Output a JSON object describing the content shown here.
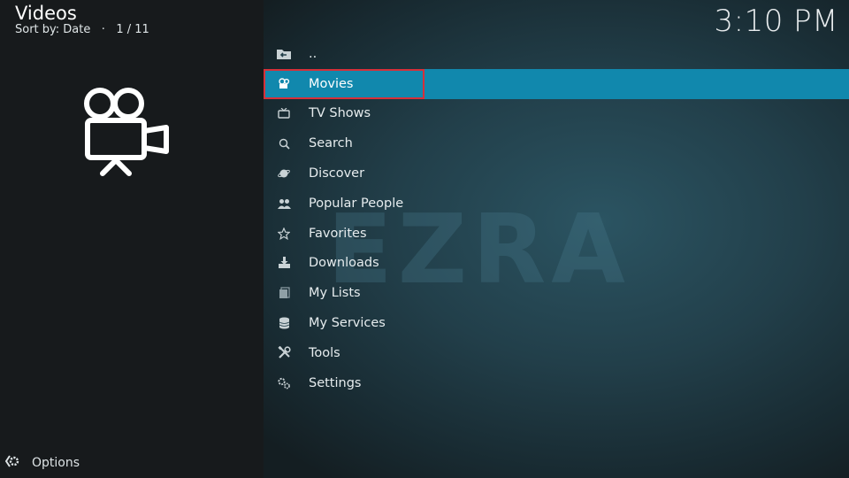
{
  "header": {
    "title": "Videos",
    "sort_text": "Sort by: Date",
    "position": "1 / 11",
    "clock": "3:10 PM"
  },
  "hero_icon": "video-camera-icon",
  "watermark": "EZRA",
  "list": [
    {
      "label": "..",
      "icon": "folder-back-icon"
    },
    {
      "label": "Movies",
      "icon": "film-reel-icon",
      "selected": true
    },
    {
      "label": "TV Shows",
      "icon": "tv-icon"
    },
    {
      "label": "Search",
      "icon": "search-icon"
    },
    {
      "label": "Discover",
      "icon": "planet-icon"
    },
    {
      "label": "Popular People",
      "icon": "people-icon"
    },
    {
      "label": "Favorites",
      "icon": "star-icon"
    },
    {
      "label": "Downloads",
      "icon": "download-icon"
    },
    {
      "label": "My Lists",
      "icon": "lists-icon"
    },
    {
      "label": "My Services",
      "icon": "database-icon"
    },
    {
      "label": "Tools",
      "icon": "tools-icon"
    },
    {
      "label": "Settings",
      "icon": "gears-icon"
    }
  ],
  "footer": {
    "options_label": "Options"
  },
  "colors": {
    "selected_bg": "#1188ad",
    "focus_border": "#d6303a"
  }
}
